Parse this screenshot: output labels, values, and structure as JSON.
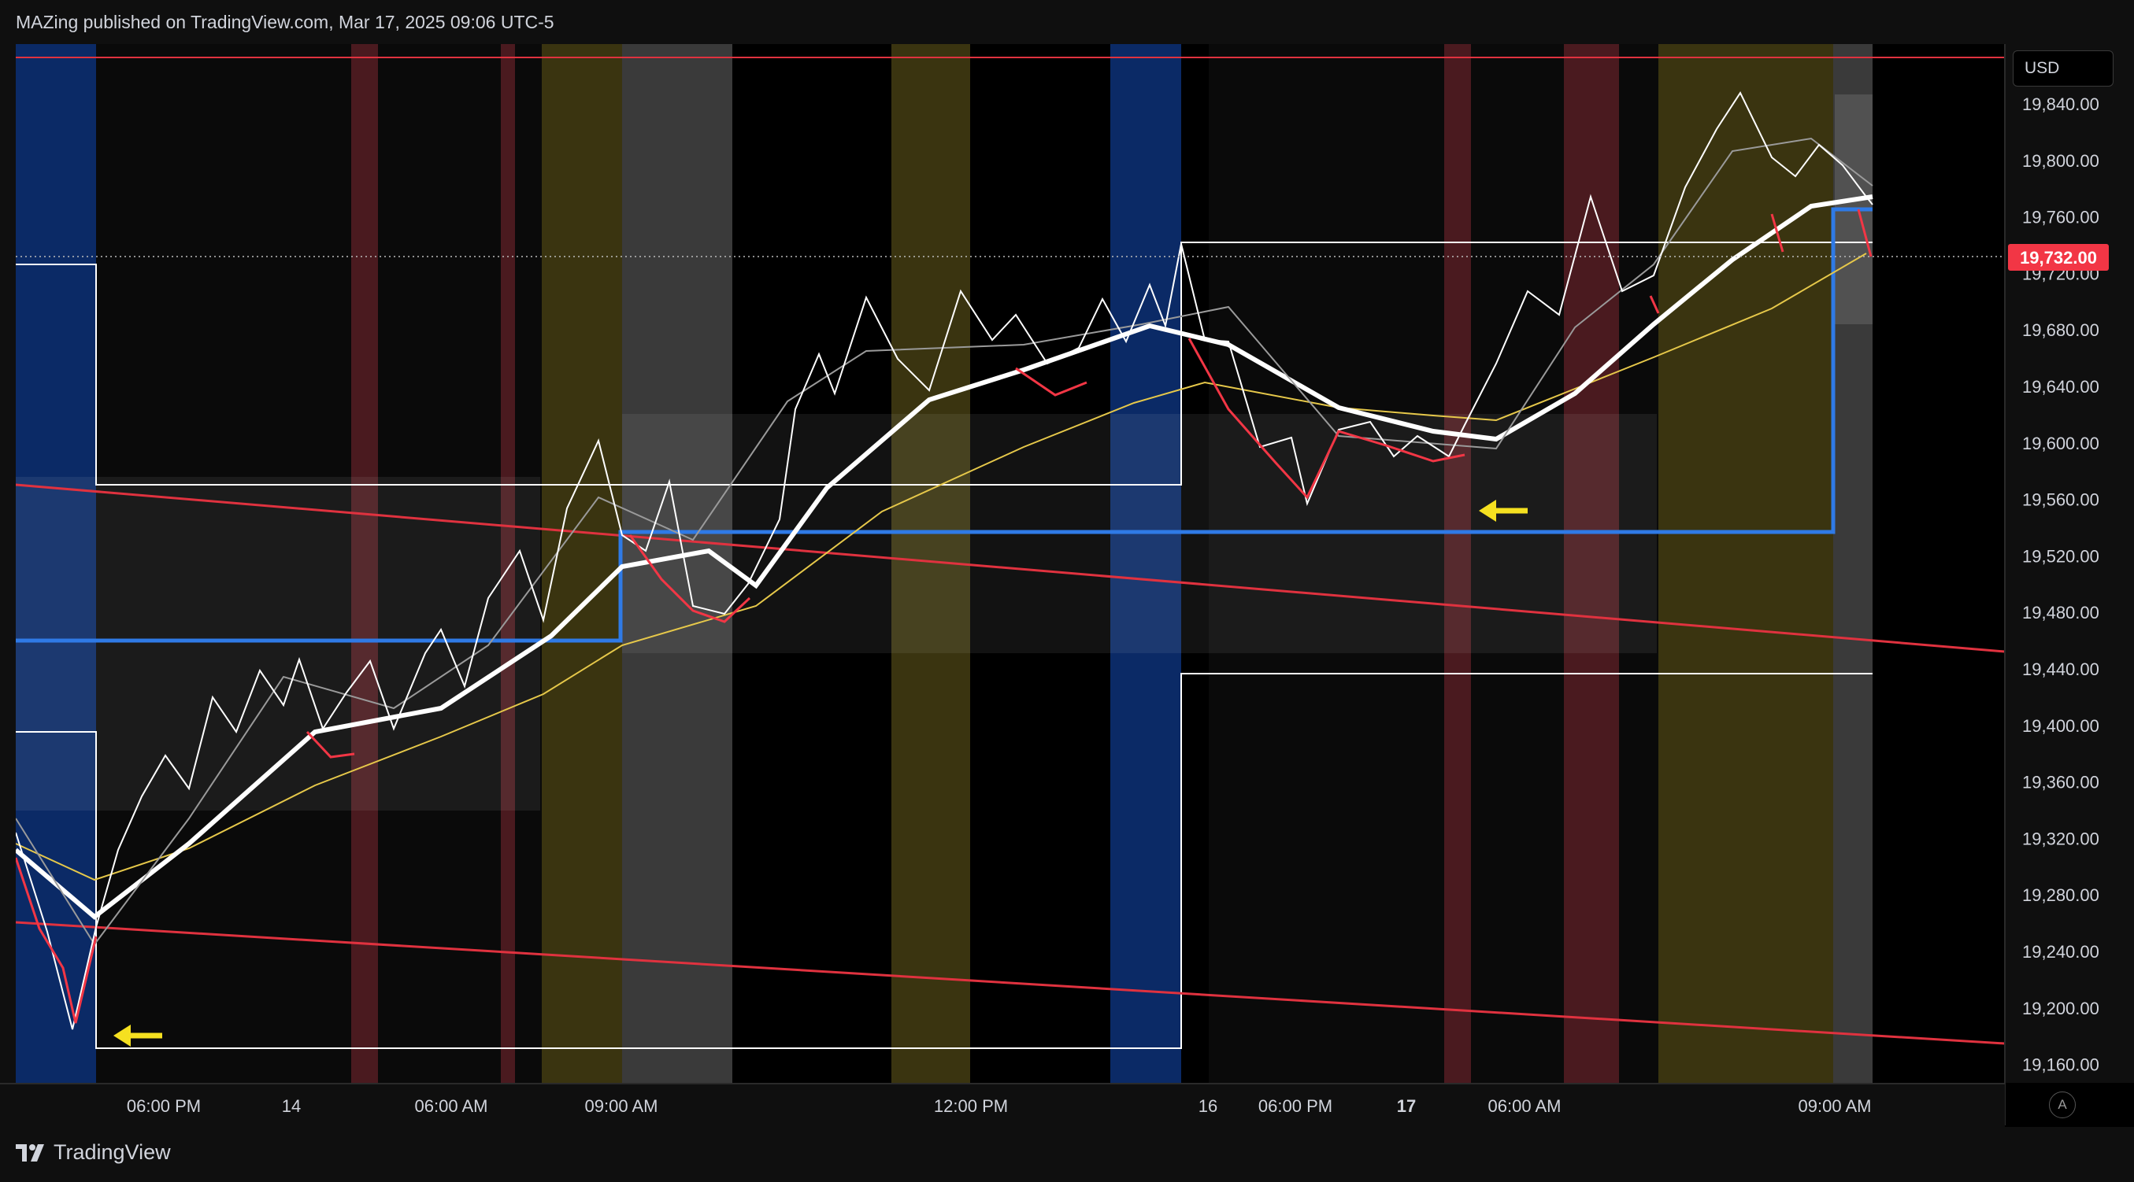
{
  "header": {
    "publish_info": "MAZing published on TradingView.com, Mar 17, 2025 09:06 UTC-5"
  },
  "price_scale": {
    "currency": "USD",
    "labels": [
      "19,840.00",
      "19,800.00",
      "19,760.00",
      "19,720.00",
      "19,680.00",
      "19,640.00",
      "19,600.00",
      "19,560.00",
      "19,520.00",
      "19,480.00",
      "19,440.00",
      "19,400.00",
      "19,360.00",
      "19,320.00",
      "19,280.00",
      "19,240.00",
      "19,200.00",
      "19,160.00"
    ],
    "current_price": "19,732.00",
    "current_price_color": "#f23645"
  },
  "time_scale": {
    "labels": [
      {
        "text": "06:00 PM",
        "bold": false
      },
      {
        "text": "14",
        "bold": false
      },
      {
        "text": "06:00 AM",
        "bold": false
      },
      {
        "text": "09:00 AM",
        "bold": false
      },
      {
        "text": "12:00 PM",
        "bold": false
      },
      {
        "text": "16",
        "bold": false
      },
      {
        "text": "06:00 PM",
        "bold": false
      },
      {
        "text": "17",
        "bold": true
      },
      {
        "text": "06:00 AM",
        "bold": false
      },
      {
        "text": "09:00 AM",
        "bold": false
      }
    ]
  },
  "colors": {
    "session_blue": "#0b2a66",
    "session_yellow": "#3a3410",
    "session_red": "#4a1a1f",
    "session_gray": "#3a3a3a",
    "price_line": "#ffffff",
    "bearish_segments": "#f23645",
    "level_blue": "#2f7ae6",
    "trendline_red": "#e0323f",
    "ma_yellow": "#e6c84a",
    "arrow_yellow": "#f5e020"
  },
  "auto_button": {
    "label": "A"
  },
  "footer": {
    "brand": "TradingView"
  }
}
